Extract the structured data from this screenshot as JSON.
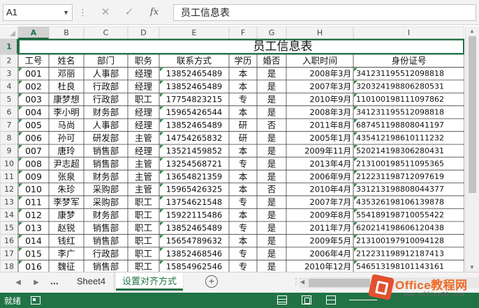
{
  "formula_bar": {
    "name_box": "A1",
    "cancel_icon": "✕",
    "enter_icon": "✓",
    "fx_label": "fx",
    "content": "员工信息表"
  },
  "sheet": {
    "column_headers": [
      "A",
      "B",
      "C",
      "D",
      "E",
      "F",
      "G",
      "H",
      "I"
    ],
    "selected_column": "A",
    "row_numbers": [
      "1",
      "2",
      "3",
      "4",
      "5",
      "6",
      "7",
      "8",
      "9",
      "10",
      "11",
      "12",
      "13",
      "14",
      "15",
      "16",
      "17",
      "18"
    ],
    "title": "员工信息表",
    "headers": [
      "工号",
      "姓名",
      "部门",
      "职务",
      "联系方式",
      "学历",
      "婚否",
      "入职时间",
      "身份证号"
    ],
    "rows": [
      [
        "001",
        "邓丽",
        "人事部",
        "经理",
        "13852465489",
        "本",
        "是",
        "2008年3月",
        "341231195512098818"
      ],
      [
        "002",
        "杜良",
        "行政部",
        "经理",
        "13852465489",
        "本",
        "是",
        "2007年3月",
        "320324198806280531"
      ],
      [
        "003",
        "康梦想",
        "行政部",
        "职工",
        "17754823215",
        "专",
        "是",
        "2010年9月",
        "110100198111097862"
      ],
      [
        "004",
        "李小明",
        "财务部",
        "经理",
        "15965426544",
        "本",
        "是",
        "2008年3月",
        "341231195512098818"
      ],
      [
        "005",
        "马尚",
        "人事部",
        "经理",
        "13852465489",
        "研",
        "否",
        "2011年8月",
        "687451198808041197"
      ],
      [
        "006",
        "孙可",
        "研发部",
        "主管",
        "14754265832",
        "研",
        "是",
        "2005年1月",
        "435412198610111232"
      ],
      [
        "007",
        "唐玲",
        "销售部",
        "经理",
        "13521459852",
        "本",
        "是",
        "2009年11月",
        "520214198306280431"
      ],
      [
        "008",
        "尹志超",
        "销售部",
        "主管",
        "13254568721",
        "专",
        "是",
        "2013年4月",
        "213100198511095365"
      ],
      [
        "009",
        "张泉",
        "财务部",
        "主管",
        "13654821359",
        "本",
        "是",
        "2006年9月",
        "212231198712097619"
      ],
      [
        "010",
        "朱珍",
        "采购部",
        "主管",
        "15965426325",
        "本",
        "否",
        "2010年4月",
        "331213198808044377"
      ],
      [
        "011",
        "李梦军",
        "采购部",
        "职工",
        "13754621548",
        "专",
        "是",
        "2007年7月",
        "435326198106139878"
      ],
      [
        "012",
        "康梦",
        "财务部",
        "职工",
        "15922115486",
        "本",
        "是",
        "2009年8月",
        "554189198710055422"
      ],
      [
        "013",
        "赵锐",
        "销售部",
        "职工",
        "13852465489",
        "专",
        "是",
        "2011年7月",
        "620214198606120438"
      ],
      [
        "014",
        "钱红",
        "销售部",
        "职工",
        "15654789632",
        "本",
        "是",
        "2009年5月",
        "213100197910094128"
      ],
      [
        "015",
        "李广",
        "行政部",
        "职工",
        "13852468546",
        "专",
        "是",
        "2006年4月",
        "212231198912187413"
      ],
      [
        "016",
        "魏征",
        "销售部",
        "职工",
        "15854962546",
        "专",
        "是",
        "2010年12月",
        "546513198101143161"
      ]
    ]
  },
  "tabs": {
    "more": "...",
    "items": [
      "Sheet4",
      "设置对齐方式"
    ],
    "active_index": 1,
    "add": "+"
  },
  "status": {
    "ready": "就绪"
  },
  "watermark": {
    "title": "Office教程网",
    "url": "www.office26.com"
  },
  "colors": {
    "excel_green": "#217346",
    "grid_line": "#d4d4d4",
    "header_bg": "#f3f3f3",
    "selected_header_bg": "#d2d2d2",
    "logo_orange": "#f06a27"
  }
}
